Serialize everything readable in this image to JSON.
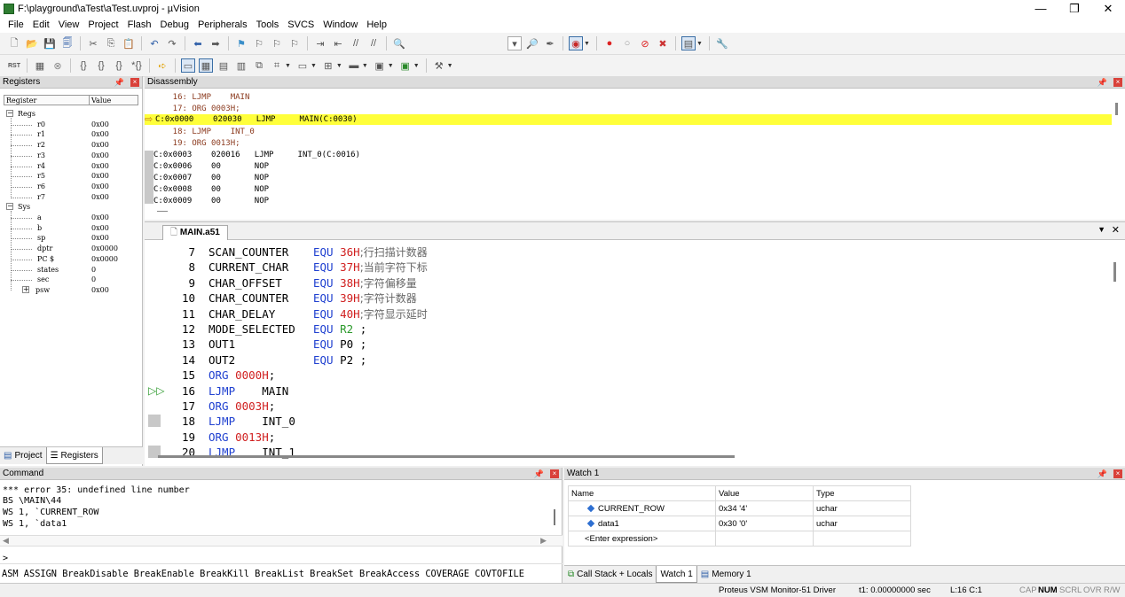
{
  "window": {
    "title": "F:\\playground\\aTest\\aTest.uvproj - µVision",
    "controls": [
      "—",
      "❐",
      "✕"
    ]
  },
  "menu": [
    "File",
    "Edit",
    "View",
    "Project",
    "Flash",
    "Debug",
    "Peripherals",
    "Tools",
    "SVCS",
    "Window",
    "Help"
  ],
  "registers": {
    "title": "Registers",
    "col_register": "Register",
    "col_value": "Value",
    "groups": [
      {
        "name": "Regs",
        "items": [
          {
            "name": "r0",
            "value": "0x00"
          },
          {
            "name": "r1",
            "value": "0x00"
          },
          {
            "name": "r2",
            "value": "0x00"
          },
          {
            "name": "r3",
            "value": "0x00"
          },
          {
            "name": "r4",
            "value": "0x00"
          },
          {
            "name": "r5",
            "value": "0x00"
          },
          {
            "name": "r6",
            "value": "0x00"
          },
          {
            "name": "r7",
            "value": "0x00"
          }
        ]
      },
      {
        "name": "Sys",
        "items": [
          {
            "name": "a",
            "value": "0x00"
          },
          {
            "name": "b",
            "value": "0x00"
          },
          {
            "name": "sp",
            "value": "0x00"
          },
          {
            "name": "dptr",
            "value": "0x0000"
          },
          {
            "name": "PC  $",
            "value": "0x0000"
          },
          {
            "name": "states",
            "value": "0"
          },
          {
            "name": "sec",
            "value": "0"
          },
          {
            "name": "psw",
            "value": "0x00"
          }
        ]
      }
    ],
    "tabs": [
      "Project",
      "Registers"
    ]
  },
  "disassembly": {
    "title": "Disassembly",
    "lines": [
      "    16: LJMP    MAIN",
      "    17: ORG 0003H;",
      "C:0x0000    020030   LJMP     MAIN(C:0030)",
      "    18: LJMP    INT_0",
      "    19: ORG 0013H;",
      "C:0x0003    020016   LJMP     INT_0(C:0016)",
      "C:0x0006    00       NOP",
      "C:0x0007    00       NOP",
      "C:0x0008    00       NOP",
      "C:0x0009    00       NOP"
    ]
  },
  "editor": {
    "tab": "MAIN.a51",
    "lines": [
      {
        "n": "7",
        "a": "SCAN_COUNTER",
        "b": "EQU",
        "c": "36H",
        "d": ";行扫描计数器"
      },
      {
        "n": "8",
        "a": "CURRENT_CHAR",
        "b": "EQU",
        "c": "37H",
        "d": ";当前字符下标"
      },
      {
        "n": "9",
        "a": "CHAR_OFFSET",
        "b": "EQU",
        "c": "38H",
        "d": ";字符偏移量"
      },
      {
        "n": "10",
        "a": "CHAR_COUNTER",
        "b": "EQU",
        "c": "39H",
        "d": ";字符计数器"
      },
      {
        "n": "11",
        "a": "CHAR_DELAY",
        "b": "EQU",
        "c": "40H",
        "d": ";字符显示延时"
      },
      {
        "n": "12",
        "a": "MODE_SELECTED",
        "b": "EQU",
        "c": "R2",
        "d": " ;"
      },
      {
        "n": "13",
        "a": "OUT1",
        "b": "EQU",
        "c": "P0",
        "d": " ;"
      },
      {
        "n": "14",
        "a": "OUT2",
        "b": "EQU",
        "c": "P2",
        "d": " ;"
      },
      {
        "n": "15",
        "a": "ORG",
        "b": "0000H",
        "c": ";",
        "d": ""
      },
      {
        "n": "16",
        "a": "LJMP",
        "b": "MAIN",
        "c": "",
        "d": ""
      },
      {
        "n": "17",
        "a": "ORG",
        "b": "0003H",
        "c": ";",
        "d": ""
      },
      {
        "n": "18",
        "a": "LJMP",
        "b": "INT_0",
        "c": "",
        "d": ""
      },
      {
        "n": "19",
        "a": "ORG",
        "b": "0013H",
        "c": ";",
        "d": ""
      },
      {
        "n": "20",
        "a": "LJMP",
        "b": "INT_1",
        "c": "",
        "d": ""
      }
    ]
  },
  "command": {
    "title": "Command",
    "output": [
      "*** error 35: undefined line number",
      "BS \\MAIN\\44",
      "WS 1, `CURRENT_ROW",
      "WS 1, `data1"
    ],
    "prompt": ">",
    "hints": "ASM ASSIGN BreakDisable BreakEnable BreakKill BreakList BreakSet BreakAccess COVERAGE COVTOFILE"
  },
  "watch": {
    "title": "Watch 1",
    "headers": [
      "Name",
      "Value",
      "Type"
    ],
    "rows": [
      {
        "name": "CURRENT_ROW",
        "value": "0x34 '4'",
        "type": "uchar"
      },
      {
        "name": "data1",
        "value": "0x30 '0'",
        "type": "uchar"
      }
    ],
    "enter": "<Enter expression>",
    "tabs": [
      "Call Stack + Locals",
      "Watch 1",
      "Memory 1"
    ]
  },
  "status": {
    "driver": "Proteus VSM Monitor-51 Driver",
    "time": "t1: 0.00000000 sec",
    "pos": "L:16 C:1",
    "flags": [
      "CAP",
      "NUM",
      "SCRL",
      "OVR",
      "R/W"
    ]
  }
}
